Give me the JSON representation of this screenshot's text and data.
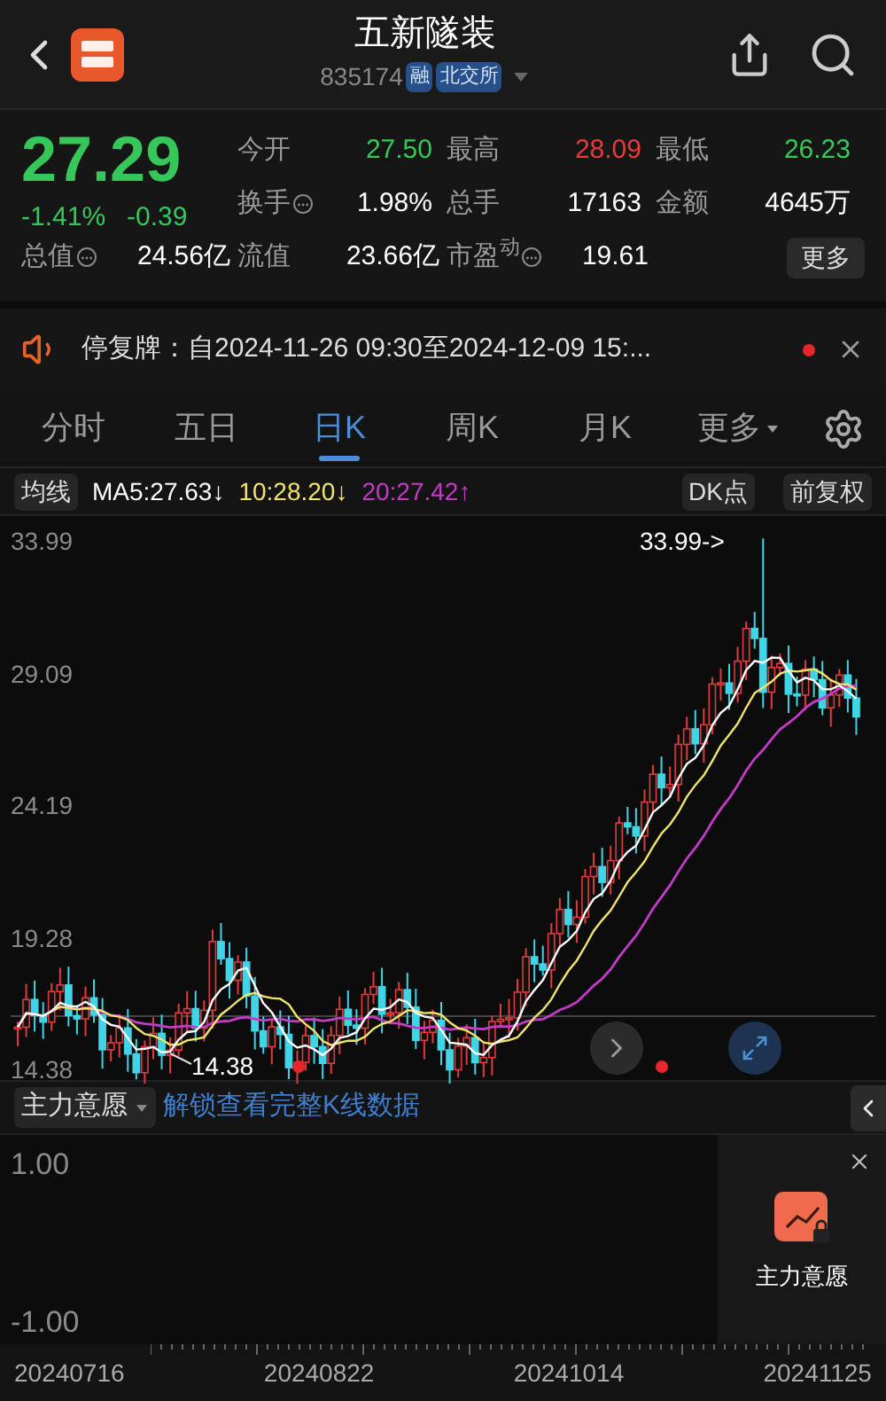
{
  "header": {
    "title": "五新隧装",
    "code": "835174",
    "badges": [
      "融",
      "北交所"
    ]
  },
  "quote": {
    "price": "27.29",
    "change_pct": "-1.41%",
    "change": "-0.39",
    "color": "#35c759",
    "stats": [
      {
        "label": "今开",
        "value": "27.50",
        "color": "#35c759",
        "info": false
      },
      {
        "label": "最高",
        "value": "28.09",
        "color": "#e8393b",
        "info": false
      },
      {
        "label": "最低",
        "value": "26.23",
        "color": "#35c759",
        "info": false
      },
      {
        "label": "换手",
        "value": "1.98%",
        "color": "#ffffff",
        "info": true
      },
      {
        "label": "总手",
        "value": "17163",
        "color": "#ffffff",
        "info": false
      },
      {
        "label": "金额",
        "value": "4645万",
        "color": "#ffffff",
        "info": false
      },
      {
        "label": "总值",
        "value": "24.56亿",
        "color": "#ffffff",
        "info": true
      },
      {
        "label": "流值",
        "value": "23.66亿",
        "color": "#ffffff",
        "info": false
      },
      {
        "label": "市盈$^{动}$",
        "value": "19.61",
        "color": "#ffffff",
        "info": true
      }
    ],
    "more_button": "更多"
  },
  "notice": {
    "label": "停复牌：",
    "text": "自2024-11-26 09:30至2024-12-09 15:...",
    "unread": true
  },
  "tabs": [
    {
      "label": "分时",
      "selected": false,
      "has_menu": false
    },
    {
      "label": "五日",
      "selected": false,
      "has_menu": false
    },
    {
      "label": "日K",
      "selected": true,
      "has_menu": false
    },
    {
      "label": "周K",
      "selected": false,
      "has_menu": false
    },
    {
      "label": "月K",
      "selected": false,
      "has_menu": false
    },
    {
      "label": "更多",
      "selected": false,
      "has_menu": true
    }
  ],
  "ma_bar": {
    "selector": "均线",
    "items": [
      {
        "label": "MA5:27.63↓",
        "color": "#ffffff"
      },
      {
        "label": "10:28.20↓",
        "color": "#f2e36b"
      },
      {
        "label": "20:27.42↑",
        "color": "#c33bc7"
      }
    ],
    "buttons": [
      "DK点",
      "前复权"
    ]
  },
  "chart": {
    "y_labels": [
      "33.99",
      "29.09",
      "24.19",
      "19.28",
      "14.38"
    ],
    "high_label": "33.99->",
    "low_label": "14.38"
  },
  "indicator": {
    "selector": "主力意愿",
    "unlock_link": "解锁查看完整K线数据"
  },
  "sub_chart": {
    "y_labels": [
      "1.00",
      "-1.00"
    ],
    "side_card": "主力意愿"
  },
  "x_labels": [
    "20240716",
    "20240822",
    "20241014",
    "20241125"
  ]
}
